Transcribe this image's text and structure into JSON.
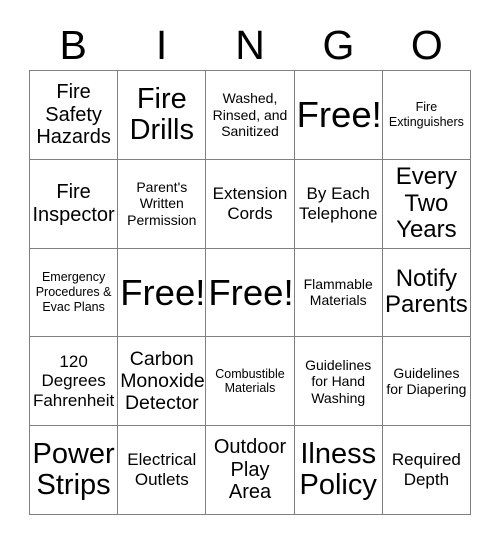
{
  "card": {
    "title_letters": [
      "B",
      "I",
      "N",
      "G",
      "O"
    ],
    "columns": 5,
    "rows": 5,
    "free_space_label": "Free!",
    "colors": {
      "text": "#000000",
      "background": "#ffffff",
      "grid_line": "#808080"
    },
    "cells": [
      {
        "row": 1,
        "col": 1,
        "text": "Fire Safety Hazards",
        "size": "md",
        "free": false
      },
      {
        "row": 1,
        "col": 2,
        "text": "Fire Drills",
        "size": "xl",
        "free": false
      },
      {
        "row": 1,
        "col": 3,
        "text": "Washed, Rinsed, and Sanitized",
        "size": "xs",
        "free": false
      },
      {
        "row": 1,
        "col": 4,
        "text": "Free!",
        "size": "xxl",
        "free": true
      },
      {
        "row": 1,
        "col": 5,
        "text": "Fire Extinguishers",
        "size": "xxs",
        "free": false
      },
      {
        "row": 2,
        "col": 1,
        "text": "Fire Inspector",
        "size": "md",
        "free": false
      },
      {
        "row": 2,
        "col": 2,
        "text": "Parent's Written Permission",
        "size": "xs",
        "free": false
      },
      {
        "row": 2,
        "col": 3,
        "text": "Extension Cords",
        "size": "sm",
        "free": false
      },
      {
        "row": 2,
        "col": 4,
        "text": "By Each Telephone",
        "size": "sm",
        "free": false
      },
      {
        "row": 2,
        "col": 5,
        "text": "Every Two Years",
        "size": "lg",
        "free": false
      },
      {
        "row": 3,
        "col": 1,
        "text": "Emergency Procedures & Evac Plans",
        "size": "xxs",
        "free": false
      },
      {
        "row": 3,
        "col": 2,
        "text": "Free!",
        "size": "xxl",
        "free": true
      },
      {
        "row": 3,
        "col": 3,
        "text": "Free!",
        "size": "xxl",
        "free": true
      },
      {
        "row": 3,
        "col": 4,
        "text": "Flammable Materials",
        "size": "xs",
        "free": false
      },
      {
        "row": 3,
        "col": 5,
        "text": "Notify Parents",
        "size": "lg",
        "free": false
      },
      {
        "row": 4,
        "col": 1,
        "text": "120 Degrees Fahrenheit",
        "size": "sm",
        "free": false
      },
      {
        "row": 4,
        "col": 2,
        "text": "Carbon Monoxide Detector",
        "size": "md",
        "free": false
      },
      {
        "row": 4,
        "col": 3,
        "text": "Combustible Materials",
        "size": "xxs",
        "free": false
      },
      {
        "row": 4,
        "col": 4,
        "text": "Guidelines for Hand Washing",
        "size": "xs",
        "free": false
      },
      {
        "row": 4,
        "col": 5,
        "text": "Guidelines for Diapering",
        "size": "xs",
        "free": false
      },
      {
        "row": 5,
        "col": 1,
        "text": "Power Strips",
        "size": "xl",
        "free": false
      },
      {
        "row": 5,
        "col": 2,
        "text": "Electrical Outlets",
        "size": "sm",
        "free": false
      },
      {
        "row": 5,
        "col": 3,
        "text": "Outdoor Play Area",
        "size": "md",
        "free": false
      },
      {
        "row": 5,
        "col": 4,
        "text": "Ilness Policy",
        "size": "xl",
        "free": false
      },
      {
        "row": 5,
        "col": 5,
        "text": "Required Depth",
        "size": "sm",
        "free": false
      }
    ]
  }
}
